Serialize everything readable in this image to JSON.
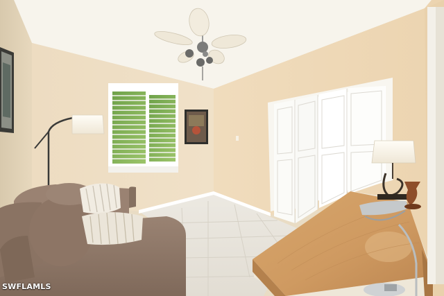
{
  "watermark": {
    "text": "SWFLAMLS"
  },
  "colors": {
    "wall": "#eddcc1",
    "ceiling": "#f7f4ec",
    "floor_tile": "#e9e5dc",
    "closet_door": "#ffffff",
    "sofa": "#8e7767",
    "desk_wood": "#cf9a61",
    "lamp_shade": "#fcf9f2"
  }
}
